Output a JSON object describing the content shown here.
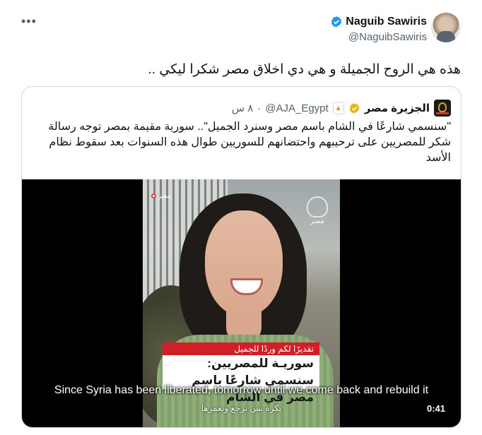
{
  "author": {
    "name": "Naguib Sawiris",
    "handle": "@NaguibSawiris"
  },
  "tweet": {
    "text": "هذه هي الروح الجميلة و هي دي اخلاق مصر شكرا ليكي .."
  },
  "quoted": {
    "name": "الجزيرة مصر",
    "handle": "@AJA_Egypt",
    "separator": "·",
    "time": "٨ س",
    "text": "\"سنسمي شارعًا في الشام باسم مصر وسنرد الجميل\".. سورية مقيمة بمصر توجه رسالة شكر للمصريين على ترحيبهم واحتضانهم للسوريين طوال هذه السنوات بعد سقوط نظام الأسد"
  },
  "video": {
    "live_label": "مصر",
    "logo_label": "مصر",
    "caption_red": "تقديرًا لكم وردًا للجميل",
    "caption_white": "سوريـة للمصريين: سنسمي شارعًا باسم مصر في الشام",
    "subtitle_en": "Since Syria has been liberated, tomorrow until we come back and rebuild it",
    "subtitle_ar": "بكرة بس نرجع ونعمرها",
    "duration": "0:41"
  },
  "colors": {
    "verified_blue": "#1d9bf0",
    "gold_badge": "#e2b719",
    "caption_red": "#d11f2a"
  },
  "icons": {
    "more": "more-options-icon",
    "verified": "verified-badge-icon",
    "gold": "gold-verified-badge-icon"
  }
}
